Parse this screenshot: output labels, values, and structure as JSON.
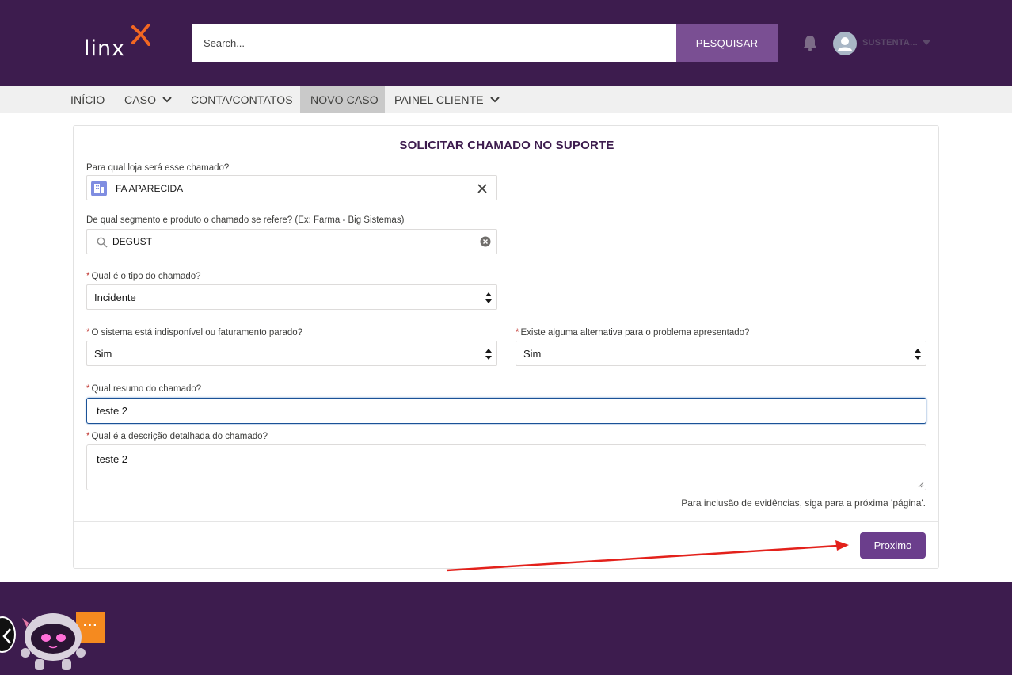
{
  "header": {
    "logo_text": "linx",
    "search_placeholder": "Search...",
    "search_button": "PESQUISAR",
    "user_name": "SUSTENTA..."
  },
  "nav": {
    "items": [
      {
        "label": "INÍCIO",
        "has_dropdown": false,
        "active": false
      },
      {
        "label": "CASO",
        "has_dropdown": true,
        "active": false
      },
      {
        "label": "CONTA/CONTATOS",
        "has_dropdown": false,
        "active": false
      },
      {
        "label": "NOVO CASO",
        "has_dropdown": false,
        "active": true
      },
      {
        "label": "PAINEL CLIENTE",
        "has_dropdown": true,
        "active": false
      }
    ]
  },
  "form": {
    "title": "SOLICITAR CHAMADO NO SUPORTE",
    "store": {
      "label": "Para qual loja será esse chamado?",
      "value": "FA APARECIDA"
    },
    "segment": {
      "label": "De qual segmento e produto o chamado se refere? (Ex: Farma - Big Sistemas)",
      "value": "DEGUST"
    },
    "type": {
      "label": "Qual é o tipo do chamado?",
      "value": "Incidente",
      "required": true
    },
    "system_down": {
      "label": "O sistema está indisponível ou faturamento parado?",
      "value": "Sim",
      "required": true
    },
    "alternative": {
      "label": "Existe alguma alternativa para o problema apresentado?",
      "value": "Sim",
      "required": true
    },
    "summary": {
      "label": "Qual resumo do chamado?",
      "value": "teste 2",
      "required": true
    },
    "description": {
      "label": "Qual é a descrição detalhada do chamado?",
      "value": "teste 2",
      "required": true
    },
    "hint": "Para inclusão de evidências, siga para a próxima 'página'.",
    "next_button": "Proximo",
    "required_mark": "*"
  },
  "chat": {
    "menu_glyph": "···"
  },
  "colors": {
    "brand_purple": "#3d1c4e",
    "button_purple": "#6b3e8c",
    "search_button": "#7a4f93",
    "logo_accent": "#f26722",
    "annotation_arrow": "#e3211b"
  }
}
